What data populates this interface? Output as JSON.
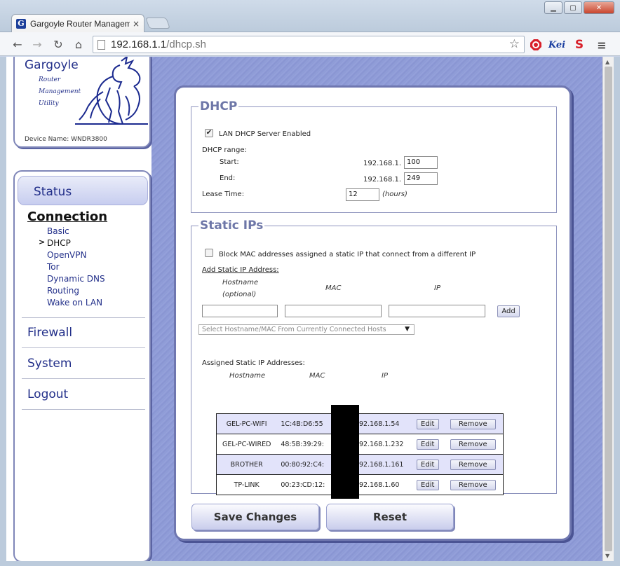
{
  "browser": {
    "tab_title": "Gargoyle Router Managem",
    "tab_close": "×",
    "favicon_letter": "G",
    "url_host": "192.168.1.1",
    "url_path": "/dhcp.sh"
  },
  "logo": {
    "title": "Gargoyle",
    "line1": "Router",
    "line2": "Management",
    "line3": "Utility",
    "device_name": "Device Name:  WNDR3800"
  },
  "nav": {
    "status": "Status",
    "connection": "Connection",
    "sub_items": [
      "Basic",
      "DHCP",
      "OpenVPN",
      "Tor",
      "Dynamic DNS",
      "Routing",
      "Wake on LAN"
    ],
    "active_marker": ">",
    "firewall": "Firewall",
    "system": "System",
    "logout": "Logout"
  },
  "dhcp": {
    "legend": "DHCP",
    "enabled_label": "LAN DHCP Server Enabled",
    "enabled": true,
    "range_label": "DHCP range:",
    "start_label": "Start:",
    "end_label": "End:",
    "prefix": "192.168.1.",
    "start_value": "100",
    "end_value": "249",
    "lease_label": "Lease Time:",
    "lease_value": "12",
    "lease_unit": "(hours)"
  },
  "static_ips": {
    "legend": "Static IPs",
    "block_label": "Block MAC addresses assigned a static IP that connect from a different IP",
    "block_checked": false,
    "add_label": "Add Static IP Address:",
    "col_hostname": "Hostname",
    "col_optional": "(optional)",
    "col_mac": "MAC",
    "col_ip": "IP",
    "add_button": "Add",
    "select_placeholder": "Select Hostname/MAC From Currently Connected Hosts",
    "assigned_label": "Assigned Static IP Addresses:",
    "table_headers": {
      "hostname": "Hostname",
      "mac": "MAC",
      "ip": "IP"
    },
    "rows": [
      {
        "hostname": "GEL-PC-WIFI",
        "mac": "1C:4B:D6:55",
        "ip": "192.168.1.54"
      },
      {
        "hostname": "GEL-PC-WIRED",
        "mac": "48:5B:39:29:",
        "ip": "192.168.1.232"
      },
      {
        "hostname": "BROTHER",
        "mac": "00:80:92:C4:",
        "ip": "192.168.1.161"
      },
      {
        "hostname": "TP-LINK",
        "mac": "00:23:CD:12:",
        "ip": "192.168.1.60"
      }
    ],
    "edit_label": "Edit",
    "remove_label": "Remove"
  },
  "actions": {
    "save": "Save Changes",
    "reset": "Reset"
  }
}
